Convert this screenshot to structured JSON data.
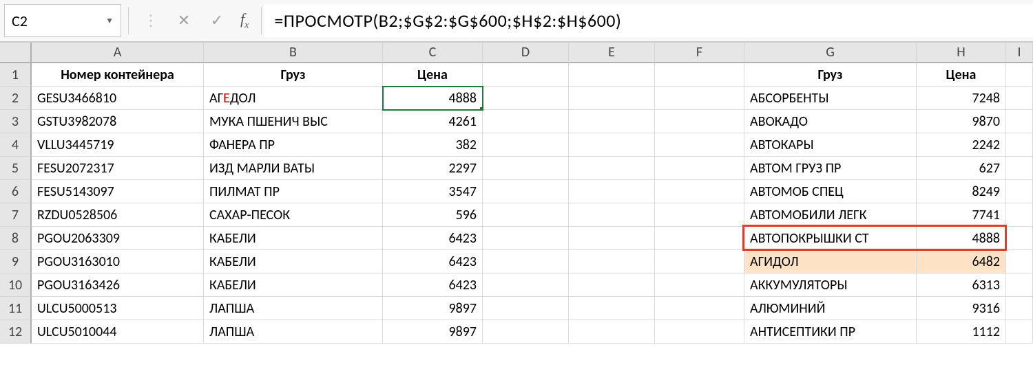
{
  "formula_bar": {
    "cell_ref": "C2",
    "formula": "=ПРОСМОТР(B2;$G$2:$G$600;$H$2:$H$600)"
  },
  "column_letters": [
    "A",
    "B",
    "C",
    "D",
    "E",
    "F",
    "G",
    "H",
    "I"
  ],
  "row_numbers": [
    "1",
    "2",
    "3",
    "4",
    "5",
    "6",
    "7",
    "8",
    "9",
    "10",
    "11",
    "12"
  ],
  "headers_left": {
    "A": "Номер контейнера",
    "B": "Груз",
    "C": "Цена"
  },
  "headers_right": {
    "G": "Груз",
    "H": "Цена"
  },
  "left_rows": [
    {
      "A": "GESU3466810",
      "B_pre": "АГ",
      "B_red": "Е",
      "B_post": "ДОЛ",
      "C": "4888"
    },
    {
      "A": "GSTU3982078",
      "B": "МУКА ПШЕНИЧ ВЫС",
      "C": "4261"
    },
    {
      "A": "VLLU3445719",
      "B": "ФАНЕРА ПР",
      "C": "382"
    },
    {
      "A": "FESU2072317",
      "B": "ИЗД МАРЛИ ВАТЫ",
      "C": "2297"
    },
    {
      "A": "FESU5143097",
      "B": "ПИЛМАТ ПР",
      "C": "3547"
    },
    {
      "A": "RZDU0528506",
      "B": "САХАР-ПЕСОК",
      "C": "596"
    },
    {
      "A": "PGOU2063309",
      "B": "КАБЕЛИ",
      "C": "6423"
    },
    {
      "A": "PGOU3163010",
      "B": "КАБЕЛИ",
      "C": "6423"
    },
    {
      "A": "PGOU3163426",
      "B": "КАБЕЛИ",
      "C": "6423"
    },
    {
      "A": "ULCU5000513",
      "B": "ЛАПША",
      "C": "9897"
    },
    {
      "A": "ULCU5010044",
      "B": "ЛАПША",
      "C": "9897"
    }
  ],
  "right_rows": [
    {
      "G": "АБСОРБЕНТЫ",
      "H": "7248"
    },
    {
      "G": "АВОКАДО",
      "H": "9870"
    },
    {
      "G": "АВТОКАРЫ",
      "H": "2242"
    },
    {
      "G": "АВТОМ ГРУЗ ПР",
      "H": "627"
    },
    {
      "G": "АВТОМОБ СПЕЦ",
      "H": "8249"
    },
    {
      "G": "АВТОМОБИЛИ ЛЕГК",
      "H": "7741"
    },
    {
      "G": "АВТОПОКРЫШКИ СТ",
      "H": "4888"
    },
    {
      "G": "АГИДОЛ",
      "H": "6482"
    },
    {
      "G": "АККУМУЛЯТОРЫ",
      "H": "6313"
    },
    {
      "G": "АЛЮМИНИЙ",
      "H": "9316"
    },
    {
      "G": "АНТИСЕПТИКИ ПР",
      "H": "1112"
    }
  ],
  "chart_data": {
    "type": "table",
    "title": "",
    "active_cell": "C2",
    "formula": "=ПРОСМОТР(B2;$G$2:$G$600;$H$2:$H$600)",
    "headers": [
      "Номер контейнера",
      "Груз",
      "Цена",
      "",
      "",
      "",
      "Груз",
      "Цена"
    ],
    "rows": [
      [
        "GESU3466810",
        "АГЕДОЛ",
        4888,
        "",
        "",
        "",
        "АБСОРБЕНТЫ",
        7248
      ],
      [
        "GSTU3982078",
        "МУКА ПШЕНИЧ ВЫС",
        4261,
        "",
        "",
        "",
        "АВОКАДО",
        9870
      ],
      [
        "VLLU3445719",
        "ФАНЕРА ПР",
        382,
        "",
        "",
        "",
        "АВТОКАРЫ",
        2242
      ],
      [
        "FESU2072317",
        "ИЗД МАРЛИ ВАТЫ",
        2297,
        "",
        "",
        "",
        "АВТОМ ГРУЗ ПР",
        627
      ],
      [
        "FESU5143097",
        "ПИЛМАТ ПР",
        3547,
        "",
        "",
        "",
        "АВТОМОБ СПЕЦ",
        8249
      ],
      [
        "RZDU0528506",
        "САХАР-ПЕСОК",
        596,
        "",
        "",
        "",
        "АВТОМОБИЛИ ЛЕГК",
        7741
      ],
      [
        "PGOU2063309",
        "КАБЕЛИ",
        6423,
        "",
        "",
        "",
        "АВТОПОКРЫШКИ СТ",
        4888
      ],
      [
        "PGOU3163010",
        "КАБЕЛИ",
        6423,
        "",
        "",
        "",
        "АГИДОЛ",
        6482
      ],
      [
        "PGOU3163426",
        "КАБЕЛИ",
        6423,
        "",
        "",
        "",
        "АККУМУЛЯТОРЫ",
        6313
      ],
      [
        "ULCU5000513",
        "ЛАПША",
        9897,
        "",
        "",
        "",
        "АЛЮМИНИЙ",
        9316
      ],
      [
        "ULCU5010044",
        "ЛАПША",
        9897,
        "",
        "",
        "",
        "АНТИСЕПТИКИ ПР",
        1112
      ]
    ],
    "annotations": [
      {
        "type": "red-box",
        "cells": "G8:H8"
      },
      {
        "type": "orange-highlight",
        "cells": "G9:H9"
      },
      {
        "type": "spellcheck-red-char",
        "cell": "B2",
        "char_index": 2
      }
    ]
  }
}
